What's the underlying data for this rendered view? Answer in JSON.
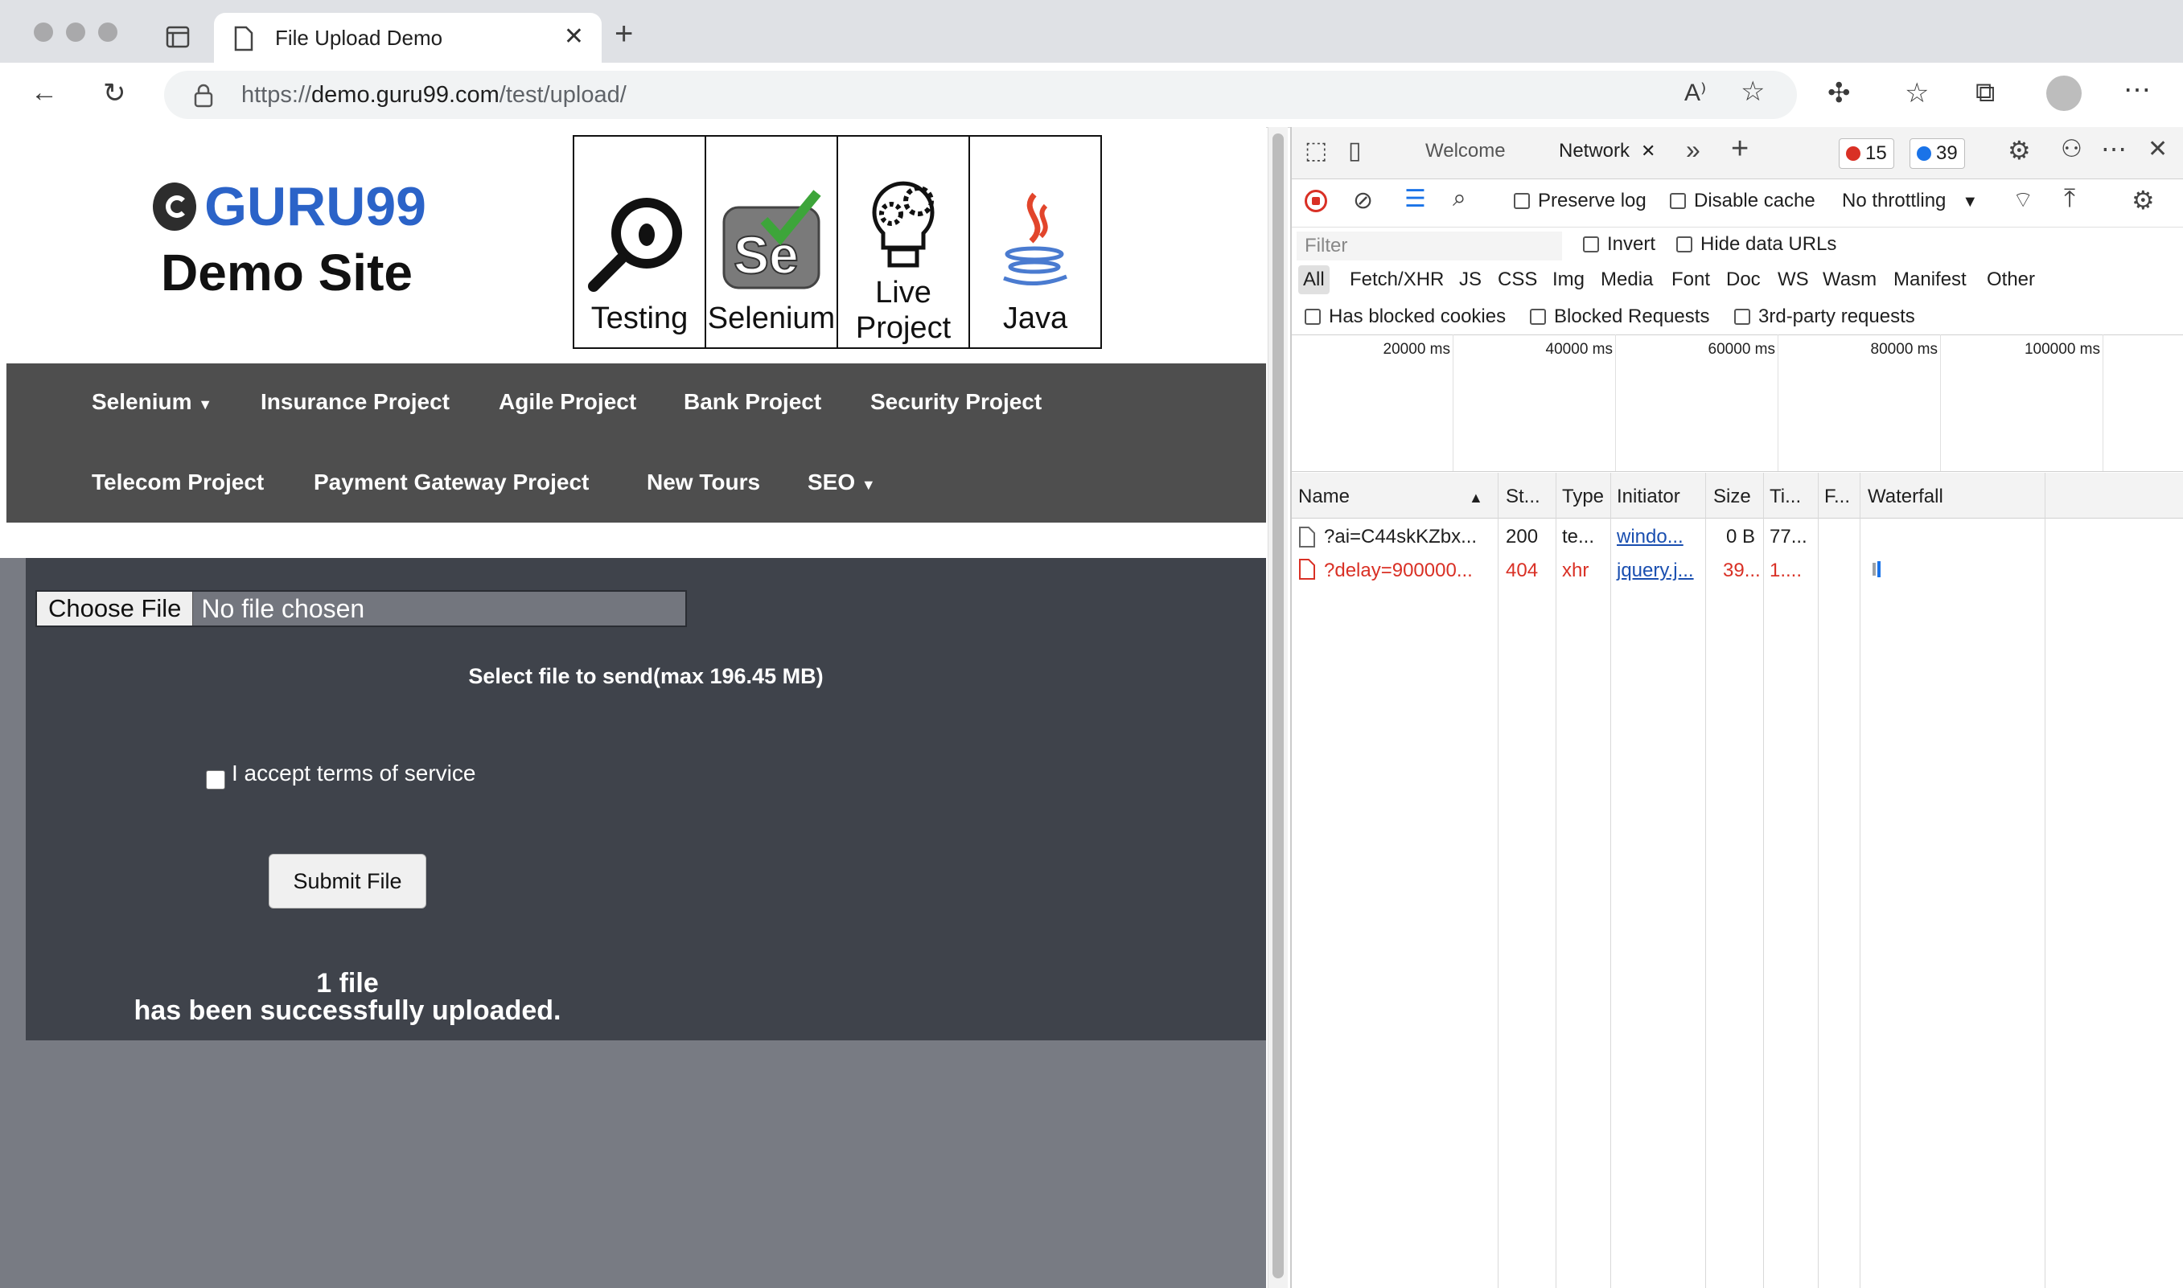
{
  "browser": {
    "tab_title": "File Upload Demo",
    "url_scheme": "https://",
    "url_host": "demo.guru99.com",
    "url_path": "/test/upload/"
  },
  "site": {
    "logo_text": "GURU99",
    "logo_subtitle": "Demo Site",
    "banner": [
      {
        "label": "Testing"
      },
      {
        "label": "Selenium"
      },
      {
        "label": "Live\nProject"
      },
      {
        "label": "Java"
      }
    ],
    "nav_row1": [
      "Selenium",
      "Insurance Project",
      "Agile Project",
      "Bank Project",
      "Security Project"
    ],
    "nav_row2": [
      "Telecom Project",
      "Payment Gateway Project",
      "New Tours",
      "SEO"
    ]
  },
  "upload": {
    "choose_button": "Choose File",
    "file_status": "No file chosen",
    "note": "Select file to send(max 196.45 MB)",
    "terms_label": "I accept terms of service",
    "submit_label": "Submit File",
    "result_line1": "1 file",
    "result_line2": "has been successfully uploaded."
  },
  "devtools": {
    "tabs": {
      "welcome": "Welcome",
      "network": "Network"
    },
    "error_count": "15",
    "message_count": "39",
    "toolbar": {
      "preserve_log": "Preserve log",
      "disable_cache": "Disable cache",
      "throttling": "No throttling"
    },
    "filter": {
      "placeholder": "Filter",
      "invert": "Invert",
      "hide_data_urls": "Hide data URLs",
      "types": [
        "All",
        "Fetch/XHR",
        "JS",
        "CSS",
        "Img",
        "Media",
        "Font",
        "Doc",
        "WS",
        "Wasm",
        "Manifest",
        "Other"
      ],
      "has_blocked_cookies": "Has blocked cookies",
      "blocked_requests": "Blocked Requests",
      "third_party": "3rd-party requests"
    },
    "timeline_ticks": [
      "20000 ms",
      "40000 ms",
      "60000 ms",
      "80000 ms",
      "100000 ms"
    ],
    "columns": [
      "Name",
      "St...",
      "Type",
      "Initiator",
      "Size",
      "Ti...",
      "F...",
      "Waterfall"
    ],
    "rows": [
      {
        "name": "?ai=C44skKZbx...",
        "status": "200",
        "type": "te...",
        "initiator": "windo...",
        "size": "0 B",
        "time": "77...",
        "error": false
      },
      {
        "name": "?delay=900000...",
        "status": "404",
        "type": "xhr",
        "initiator": "jquery.j...",
        "size": "39...",
        "time": "1....",
        "error": true
      }
    ]
  },
  "colors": {
    "nav_bg": "#4e4e4e",
    "panel_bg": "#3f434b",
    "panel_below_bg": "#787b83",
    "logo_blue": "#2b63c8",
    "error_red": "#d93025"
  }
}
